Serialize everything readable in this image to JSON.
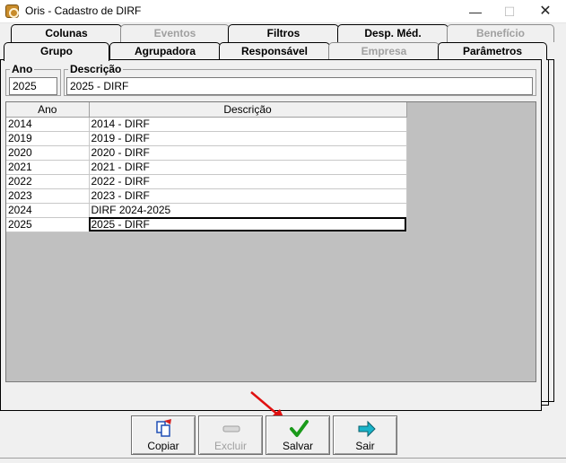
{
  "window": {
    "title": "Oris - Cadastro de DIRF",
    "minimize": "—",
    "maximize": "☐",
    "close": "✕"
  },
  "tabs_row1": [
    {
      "label": "Colunas",
      "enabled": true
    },
    {
      "label": "Eventos",
      "enabled": false
    },
    {
      "label": "Filtros",
      "enabled": true
    },
    {
      "label": "Desp. Méd.",
      "enabled": true
    },
    {
      "label": "Benefício",
      "enabled": false
    }
  ],
  "tabs_row2": [
    {
      "label": "Grupo",
      "enabled": true,
      "active": true
    },
    {
      "label": "Agrupadora",
      "enabled": true
    },
    {
      "label": "Responsável",
      "enabled": true
    },
    {
      "label": "Empresa",
      "enabled": false
    },
    {
      "label": "Parâmetros",
      "enabled": true
    }
  ],
  "form": {
    "ano_label": "Ano",
    "ano_value": "2025",
    "descricao_label": "Descrição",
    "descricao_value": "2025 - DIRF"
  },
  "grid": {
    "columns": [
      "Ano",
      "Descrição"
    ],
    "rows": [
      [
        "2014",
        "2014 - DIRF"
      ],
      [
        "2019",
        "2019 - DIRF"
      ],
      [
        "2020",
        "2020 - DIRF"
      ],
      [
        "2021",
        "2021 - DIRF"
      ],
      [
        "2022",
        "2022 - DIRF"
      ],
      [
        "2023",
        "2023 - DIRF"
      ],
      [
        "2024",
        "DIRF 2024-2025"
      ],
      [
        "2025",
        "2025 - DIRF"
      ]
    ],
    "selected_row": 7
  },
  "buttons": {
    "copiar": "Copiar",
    "excluir": "Excluir",
    "salvar": "Salvar",
    "sair": "Sair"
  },
  "colors": {
    "annotation_arrow": "#e01010",
    "check_green": "#1a9a1a",
    "exit_arrow": "#19b3c9"
  }
}
